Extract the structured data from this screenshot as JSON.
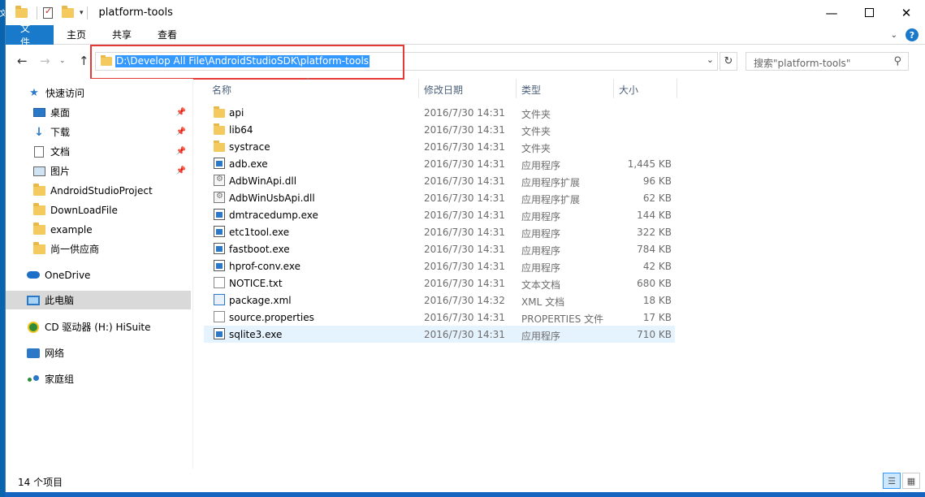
{
  "window": {
    "title": "platform-tools",
    "strip_text": "文"
  },
  "ribbon": {
    "tabs": [
      "文件",
      "主页",
      "共享",
      "查看"
    ]
  },
  "address": {
    "path": "D:\\Develop All File\\AndroidStudioSDK\\platform-tools",
    "search_placeholder": "搜索\"platform-tools\""
  },
  "nav": {
    "quick_access": "快速访问",
    "items": [
      {
        "label": "桌面",
        "icon": "desktop-icon",
        "pinned": true
      },
      {
        "label": "下载",
        "icon": "download-icon",
        "pinned": true
      },
      {
        "label": "文档",
        "icon": "document-icon",
        "pinned": true
      },
      {
        "label": "图片",
        "icon": "picture-icon",
        "pinned": true
      },
      {
        "label": "AndroidStudioProject",
        "icon": "folder-icon"
      },
      {
        "label": "DownLoadFile",
        "icon": "folder-icon"
      },
      {
        "label": "example",
        "icon": "folder-icon"
      },
      {
        "label": "尚一供应商",
        "icon": "folder-icon"
      }
    ],
    "onedrive": "OneDrive",
    "this_pc": "此电脑",
    "cd_drive": "CD 驱动器 (H:) HiSuite",
    "network": "网络",
    "homegroup": "家庭组"
  },
  "columns": {
    "name": "名称",
    "date": "修改日期",
    "type": "类型",
    "size": "大小"
  },
  "files": [
    {
      "name": "api",
      "date": "2016/7/30 14:31",
      "type": "文件夹",
      "size": "",
      "icon": "folder"
    },
    {
      "name": "lib64",
      "date": "2016/7/30 14:31",
      "type": "文件夹",
      "size": "",
      "icon": "folder"
    },
    {
      "name": "systrace",
      "date": "2016/7/30 14:31",
      "type": "文件夹",
      "size": "",
      "icon": "folder"
    },
    {
      "name": "adb.exe",
      "date": "2016/7/30 14:31",
      "type": "应用程序",
      "size": "1,445 KB",
      "icon": "exe"
    },
    {
      "name": "AdbWinApi.dll",
      "date": "2016/7/30 14:31",
      "type": "应用程序扩展",
      "size": "96 KB",
      "icon": "dll"
    },
    {
      "name": "AdbWinUsbApi.dll",
      "date": "2016/7/30 14:31",
      "type": "应用程序扩展",
      "size": "62 KB",
      "icon": "dll"
    },
    {
      "name": "dmtracedump.exe",
      "date": "2016/7/30 14:31",
      "type": "应用程序",
      "size": "144 KB",
      "icon": "exe"
    },
    {
      "name": "etc1tool.exe",
      "date": "2016/7/30 14:31",
      "type": "应用程序",
      "size": "322 KB",
      "icon": "exe"
    },
    {
      "name": "fastboot.exe",
      "date": "2016/7/30 14:31",
      "type": "应用程序",
      "size": "784 KB",
      "icon": "exe"
    },
    {
      "name": "hprof-conv.exe",
      "date": "2016/7/30 14:31",
      "type": "应用程序",
      "size": "42 KB",
      "icon": "exe"
    },
    {
      "name": "NOTICE.txt",
      "date": "2016/7/30 14:31",
      "type": "文本文档",
      "size": "680 KB",
      "icon": "doc"
    },
    {
      "name": "package.xml",
      "date": "2016/7/30 14:32",
      "type": "XML 文档",
      "size": "18 KB",
      "icon": "xml"
    },
    {
      "name": "source.properties",
      "date": "2016/7/30 14:31",
      "type": "PROPERTIES 文件",
      "size": "17 KB",
      "icon": "doc"
    },
    {
      "name": "sqlite3.exe",
      "date": "2016/7/30 14:31",
      "type": "应用程序",
      "size": "710 KB",
      "icon": "exe",
      "selected": true
    }
  ],
  "status": {
    "count": "14 个项目"
  },
  "colors": {
    "accent": "#1979ca",
    "selection": "#3399ff",
    "annotation": "#e53935"
  }
}
